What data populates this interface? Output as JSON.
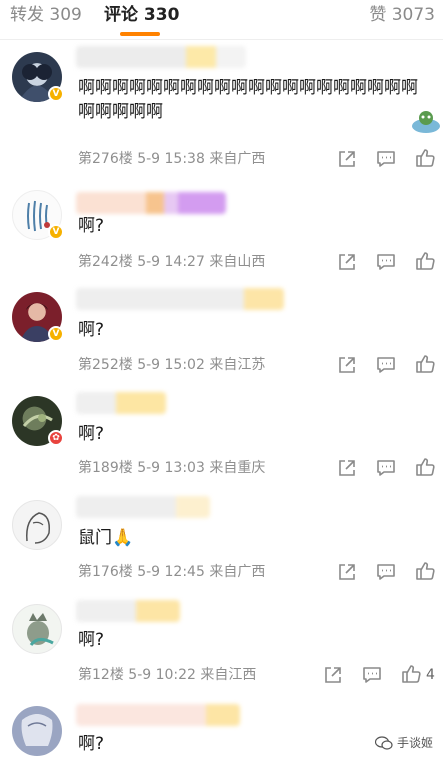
{
  "tabs": {
    "repost_label": "转发",
    "repost_count": "309",
    "comment_label": "评论",
    "comment_count": "330",
    "like_label": "赞",
    "like_count": "3073"
  },
  "accent_color": "#ff8200",
  "comments": [
    {
      "text": "啊啊啊啊啊啊啊啊啊啊啊啊啊啊啊啊啊啊啊啊啊啊啊啊啊",
      "floor": "第276楼",
      "date": "5-9",
      "time": "15:38",
      "location": "来自广西",
      "badge": "V"
    },
    {
      "text": "啊?",
      "floor": "第242楼",
      "date": "5-9",
      "time": "14:27",
      "location": "来自山西",
      "badge": "V"
    },
    {
      "text": "啊?",
      "floor": "第252楼",
      "date": "5-9",
      "time": "15:02",
      "location": "来自江苏",
      "badge": "V"
    },
    {
      "text": "啊?",
      "floor": "第189楼",
      "date": "5-9",
      "time": "13:03",
      "location": "来自重庆",
      "badge": "✿"
    },
    {
      "text": "鼠门",
      "emoji": "🙏",
      "floor": "第176楼",
      "date": "5-9",
      "time": "12:45",
      "location": "来自广西"
    },
    {
      "text": "啊?",
      "floor": "第12楼",
      "date": "5-9",
      "time": "10:22",
      "location": "来自江西",
      "likes": "4"
    },
    {
      "text": "啊?"
    }
  ],
  "watermark": "手谈姬",
  "icons": [
    "share-icon",
    "comment-icon",
    "like-icon",
    "wechat-icon"
  ]
}
